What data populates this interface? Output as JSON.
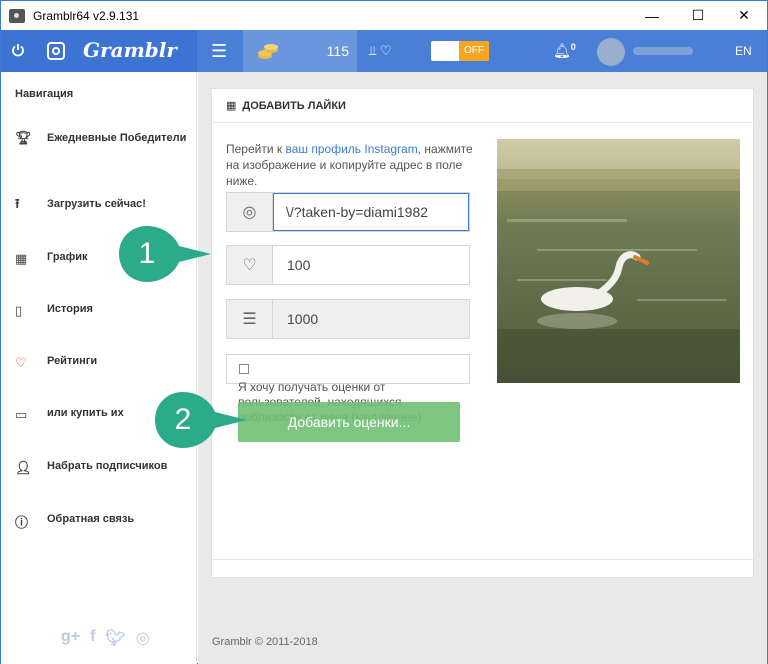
{
  "window": {
    "title": "Gramblr64 v2.9.131",
    "minimize": "—",
    "maximize": "☐",
    "close": "✕"
  },
  "topbar": {
    "logo": "Gramblr",
    "coins": "115",
    "likes_icon_text": "♡",
    "toggle_label": "OFF",
    "notifications": "0",
    "language": "EN"
  },
  "sidebar": {
    "title": "Навигация",
    "items": [
      {
        "label": "Ежедневные Победители",
        "icon": "trophy-icon"
      },
      {
        "label": "Загрузить сейчас!",
        "icon": "upload-icon"
      },
      {
        "label": "График",
        "icon": "calendar-icon"
      },
      {
        "label": "История",
        "icon": "book-icon"
      },
      {
        "label": "Рейтинги",
        "icon": "heart-icon"
      },
      {
        "label": "или купить их",
        "icon": "wallet-icon"
      },
      {
        "label": "Набрать подписчиков",
        "icon": "user-icon"
      },
      {
        "label": "Обратная связь",
        "icon": "help-icon"
      }
    ],
    "social": [
      "g+",
      "f",
      "twitter",
      "instagram"
    ]
  },
  "panel": {
    "heading": "ДОБАВИТЬ ЛАЙКИ",
    "hint_prefix": "Перейти к ",
    "hint_link": "ваш профиль Instagram",
    "hint_suffix": ", нажмите на изображение и копируйте адрес в поле ниже.",
    "url_value": "\\/?taken-by=diami1982",
    "likes_value": "100",
    "coins_value": "1000",
    "checkbox_label": "Я хочу получать оценки от пользователей, находящихся поблизости от меня (медленнее)",
    "submit_label": "Добавить оценки..."
  },
  "footer": {
    "copyright": "Gramblr © 2011-2018"
  },
  "callouts": [
    "1",
    "2"
  ],
  "colors": {
    "brand_blue": "#4a7fd8",
    "callout_green": "#2bab8a",
    "button_green": "#6fbf73",
    "toggle_orange": "#f5a623"
  }
}
